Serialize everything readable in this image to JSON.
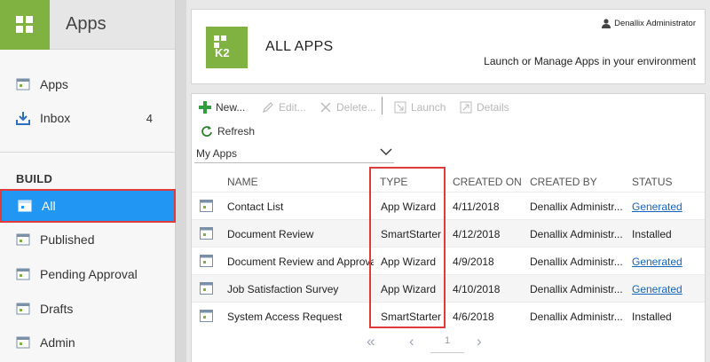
{
  "sidebar": {
    "title": "Apps",
    "section_label": "BUILD",
    "items": [
      {
        "label": "Apps",
        "count": ""
      },
      {
        "label": "Inbox",
        "count": "4"
      },
      {
        "label": "All",
        "count": ""
      },
      {
        "label": "Published",
        "count": ""
      },
      {
        "label": "Pending Approval",
        "count": ""
      },
      {
        "label": "Drafts",
        "count": ""
      },
      {
        "label": "Admin",
        "count": ""
      }
    ]
  },
  "header": {
    "logo_text": "K2",
    "title": "ALL APPS",
    "user": "Denallix Administrator",
    "tagline": "Launch or Manage Apps in your environment"
  },
  "toolbar": {
    "new_label": "New...",
    "edit_label": "Edit...",
    "delete_label": "Delete...",
    "launch_label": "Launch",
    "details_label": "Details",
    "refresh_label": "Refresh"
  },
  "filter": {
    "selected": "My Apps"
  },
  "table": {
    "columns": [
      "NAME",
      "TYPE",
      "CREATED ON",
      "CREATED BY",
      "STATUS"
    ],
    "rows": [
      {
        "name": "Contact List",
        "type": "App Wizard",
        "created_on": "4/11/2018",
        "created_by": "Denallix Administr...",
        "status": "Generated"
      },
      {
        "name": "Document Review",
        "type": "SmartStarter",
        "created_on": "4/12/2018",
        "created_by": "Denallix Administr...",
        "status": "Installed"
      },
      {
        "name": "Document Review and Approval",
        "type": "App Wizard",
        "created_on": "4/9/2018",
        "created_by": "Denallix Administr...",
        "status": "Generated"
      },
      {
        "name": "Job Satisfaction Survey",
        "type": "App Wizard",
        "created_on": "4/10/2018",
        "created_by": "Denallix Administr...",
        "status": "Generated"
      },
      {
        "name": "System Access Request",
        "type": "SmartStarter",
        "created_on": "4/6/2018",
        "created_by": "Denallix Administr...",
        "status": "Installed"
      }
    ]
  },
  "pager": {
    "page": "1"
  },
  "colors": {
    "brand_green": "#7fb241",
    "active_blue": "#2196f3",
    "highlight_red": "#e03b3b",
    "link_blue": "#1565c0"
  }
}
